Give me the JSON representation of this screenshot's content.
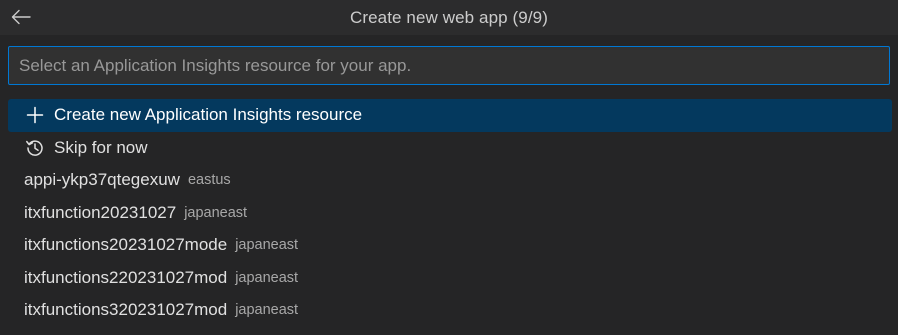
{
  "header": {
    "title": "Create new web app (9/9)",
    "back_icon": "arrow-left-icon"
  },
  "search": {
    "placeholder": "Select an Application Insights resource for your app.",
    "value": ""
  },
  "list": {
    "items": [
      {
        "label": "Create new Application Insights resource",
        "description": "",
        "icon": "add-icon",
        "selected": true
      },
      {
        "label": "Skip for now",
        "description": "",
        "icon": "history-icon",
        "selected": false
      },
      {
        "label": "appi-ykp37qtegexuw",
        "description": "eastus"
      },
      {
        "label": "itxfunction20231027",
        "description": "japaneast"
      },
      {
        "label": "itxfunctions20231027mode",
        "description": "japaneast"
      },
      {
        "label": "itxfunctions220231027mod",
        "description": "japaneast"
      },
      {
        "label": "itxfunctions320231027mod",
        "description": "japaneast"
      }
    ]
  },
  "colors": {
    "background": "#252526",
    "title_bar": "#2c2c2d",
    "input_border": "#0078d4",
    "selected_row": "#04395e",
    "description_text": "#a8a8a8"
  }
}
